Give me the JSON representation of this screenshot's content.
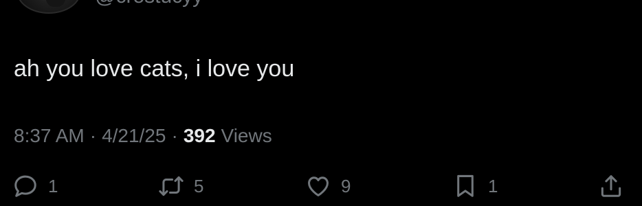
{
  "tweet": {
    "handle": "@crostucyy",
    "text": "ah you love cats, i love you",
    "time": "8:37 AM",
    "date": "4/21/25",
    "separator": "·",
    "views_count": "392",
    "views_label": "Views"
  },
  "actions": {
    "reply": {
      "icon": "reply-icon",
      "count": "1"
    },
    "retweet": {
      "icon": "retweet-icon",
      "count": "5"
    },
    "like": {
      "icon": "heart-icon",
      "count": "9"
    },
    "bookmark": {
      "icon": "bookmark-icon",
      "count": "1"
    },
    "share": {
      "icon": "share-icon"
    }
  },
  "colors": {
    "background": "#000000",
    "primary_text": "#e7e9ea",
    "secondary_text": "#71767b"
  }
}
